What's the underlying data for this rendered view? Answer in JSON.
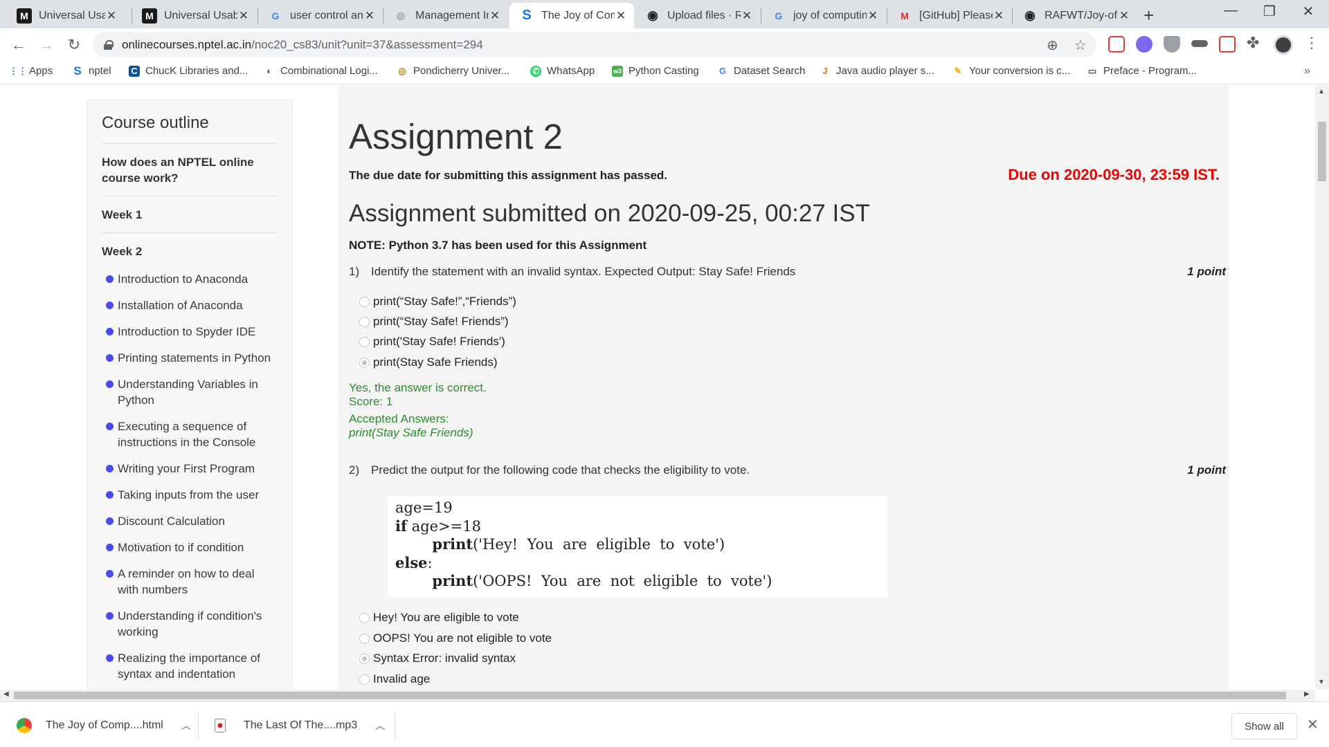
{
  "browser": {
    "tabs": [
      {
        "title": "Universal Usability",
        "favicon": "M",
        "favicon_bg": "#1a1a1a",
        "favicon_color": "#fff"
      },
      {
        "title": "Universal Usability",
        "favicon": "M",
        "favicon_bg": "#1a1a1a",
        "favicon_color": "#fff"
      },
      {
        "title": "user control and freedom",
        "favicon": "G",
        "favicon_bg": "#fff",
        "favicon_color": "#4285f4"
      },
      {
        "title": "Management Information",
        "favicon": "◎",
        "favicon_bg": "#fff",
        "favicon_color": "#999"
      },
      {
        "title": "The Joy of Computing",
        "favicon": "S",
        "favicon_bg": "#fff",
        "favicon_color": "#1a73e8"
      },
      {
        "title": "Upload files · RAFWT",
        "favicon": "◉",
        "favicon_bg": "#fff",
        "favicon_color": "#222"
      },
      {
        "title": "joy of computing",
        "favicon": "G",
        "favicon_bg": "#fff",
        "favicon_color": "#4285f4"
      },
      {
        "title": "[GitHub] Please verify",
        "favicon": "M",
        "favicon_bg": "#fff",
        "favicon_color": "#d93025"
      },
      {
        "title": "RAFWT/Joy-of-Computing",
        "favicon": "◉",
        "favicon_bg": "#fff",
        "favicon_color": "#222"
      }
    ],
    "active_tab_index": 4,
    "new_tab_label": "+",
    "window_controls": {
      "minimize": "—",
      "restore": "❐",
      "close": "✕"
    },
    "url_host": "onlinecourses.nptel.ac.in",
    "url_path": "/noc20_cs83/unit?unit=37&assessment=294",
    "bookmarks": [
      {
        "label": "Apps",
        "icon": "apps-grid-icon",
        "glyph": "⋮⋮",
        "color": "#1a73e8"
      },
      {
        "label": "nptel",
        "icon": "nptel-icon",
        "glyph": "S",
        "color": "#1a73e8"
      },
      {
        "label": "ChucK Libraries and...",
        "icon": "chuck-icon",
        "glyph": "C",
        "color": "#0b5394"
      },
      {
        "label": "Combinational Logi...",
        "icon": "combinational-logic-icon",
        "glyph": "◐",
        "color": "#555"
      },
      {
        "label": "Pondicherry Univer...",
        "icon": "pondicherry-icon",
        "glyph": "◎",
        "color": "#b8860b"
      },
      {
        "label": "WhatsApp",
        "icon": "whatsapp-icon",
        "glyph": "✆",
        "color": "#25d366"
      },
      {
        "label": "Python Casting",
        "icon": "python-casting-icon",
        "glyph": "w3",
        "color": "#4caf50"
      },
      {
        "label": "Dataset Search",
        "icon": "dataset-search-icon",
        "glyph": "G",
        "color": "#4285f4"
      },
      {
        "label": "Java audio player s...",
        "icon": "java-icon",
        "glyph": "J",
        "color": "#e8710a"
      },
      {
        "label": "Your conversion is c...",
        "icon": "conversion-icon",
        "glyph": "✎",
        "color": "#f4b400"
      },
      {
        "label": "Preface - Program...",
        "icon": "preface-icon",
        "glyph": "▭",
        "color": "#555"
      }
    ],
    "bookmarks_more": "»"
  },
  "sidebar": {
    "title": "Course outline",
    "sections": [
      "How does an NPTEL online course work?",
      "Week 1",
      "Week 2"
    ],
    "items": [
      "Introduction to Anaconda",
      "Installation of Anaconda",
      "Introduction to Spyder IDE",
      "Printing statements in Python",
      "Understanding Variables in Python",
      "Executing a sequence of instructions in the Console",
      "Writing your First Program",
      "Taking inputs from the user",
      "Discount Calculation",
      "Motivation to if condition",
      "A reminder on how to deal with numbers",
      "Understanding if condition's working",
      "Realizing the importance of syntax and indentation"
    ]
  },
  "assignment": {
    "title": "Assignment 2",
    "passed_notice": "The due date for submitting this assignment has passed.",
    "due": "Due on 2020-09-30, 23:59 IST.",
    "submitted": "Assignment submitted on 2020-09-25, 00:27 IST",
    "note": "NOTE: Python 3.7 has been used for this Assignment",
    "questions": [
      {
        "number": "1)",
        "text": "Identify the statement with an invalid syntax. Expected Output: Stay Safe! Friends",
        "points": "1 point",
        "options": [
          "print(“Stay Safe!”,“Friends”)",
          "print(“Stay Safe! Friends”)",
          "print('Stay Safe! Friends')",
          "print(Stay Safe Friends)"
        ],
        "selected": 3,
        "feedback": "Yes, the answer is correct.",
        "score": "Score: 1",
        "accepted_label": "Accepted Answers:",
        "accepted": "print(Stay Safe Friends)"
      },
      {
        "number": "2)",
        "text": "Predict the output for the following code that checks the eligibility to vote.",
        "points": "1 point",
        "code": {
          "l1": "age=19",
          "l2_kw": "if",
          "l2": " age>=18",
          "l3_kw": "print",
          "l3": "('Hey!  You  are  eligible  to  vote')",
          "l4_kw": "else",
          "l4": ":",
          "l5_kw": "print",
          "l5": "('OOPS!  You  are  not  eligible  to  vote')"
        },
        "options": [
          "Hey! You are eligible to vote",
          "OOPS! You are not eligible to vote",
          "Syntax Error: invalid syntax",
          "Invalid age"
        ],
        "selected": 2
      }
    ]
  },
  "downloads": {
    "items": [
      {
        "name": "The Joy of Comp....html",
        "icon": "chrome-icon"
      },
      {
        "name": "The Last Of The....mp3",
        "icon": "audio-file-icon"
      }
    ],
    "show_all": "Show all",
    "close": "✕"
  }
}
